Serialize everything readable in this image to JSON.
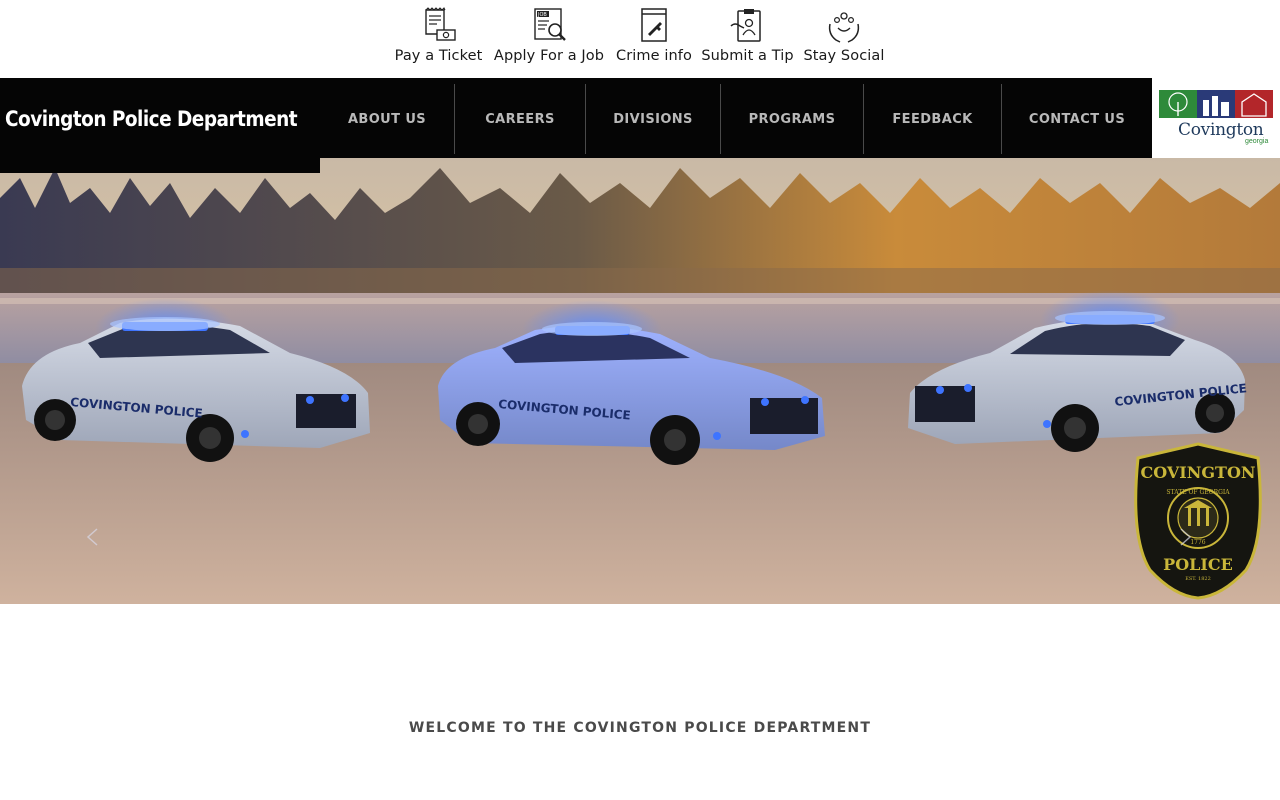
{
  "quick_links": [
    {
      "label": "Pay a Ticket",
      "icon": "ticket-cash-icon"
    },
    {
      "label": "Apply For a Job",
      "icon": "job-search-icon"
    },
    {
      "label": "Crime info",
      "icon": "evidence-bag-icon"
    },
    {
      "label": "Submit a Tip",
      "icon": "clipboard-tip-icon"
    },
    {
      "label": "Stay Social",
      "icon": "social-hands-icon"
    }
  ],
  "brand": {
    "title": "Covington Police Department",
    "badge_icon": "police-badge-icon"
  },
  "nav": {
    "items": [
      "ABOUT US",
      "CAREERS",
      "DIVISIONS",
      "PROGRAMS",
      "FEEDBACK",
      "CONTACT US"
    ]
  },
  "city_logo": {
    "name": "Covington",
    "subtitle": "georgia"
  },
  "hero": {
    "car_text": "COVINGTON POLICE",
    "patch_top": "COVINGTON",
    "patch_bottom": "POLICE",
    "patch_ring": "STATE OF GEORGIA",
    "patch_year": "1776",
    "patch_est": "EST. 1822"
  },
  "welcome": {
    "heading": "WELCOME TO THE COVINGTON POLICE DEPARTMENT"
  },
  "colors": {
    "header_bg": "#050505",
    "nav_text": "#b9b9b9",
    "light_blue": "#2f6bff",
    "city_blue": "#1f3a5c",
    "city_green": "#2e8a3a"
  }
}
